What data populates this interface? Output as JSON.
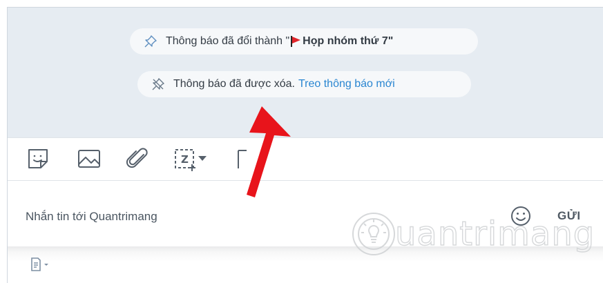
{
  "notifications": {
    "renamed": {
      "prefix": "Thông báo đã đổi thành \"",
      "title": "Họp nhóm thứ 7",
      "suffix": "\""
    },
    "deleted": {
      "text": "Thông báo đã được xóa.",
      "link": "Treo thông báo mới"
    }
  },
  "toolbar": {
    "icons": [
      "sticker-icon",
      "image-icon",
      "attachment-icon",
      "screenshot-icon",
      "format-icon"
    ]
  },
  "composer": {
    "placeholder": "Nhắn tin tới Quantrimang",
    "send_label": "GỬI"
  },
  "watermark": {
    "text": "uantrimang"
  },
  "colors": {
    "accent": "#2a86d1",
    "flag": "#e0262b",
    "arrow": "#e8141b",
    "chat_bg": "#e6ecf2"
  }
}
